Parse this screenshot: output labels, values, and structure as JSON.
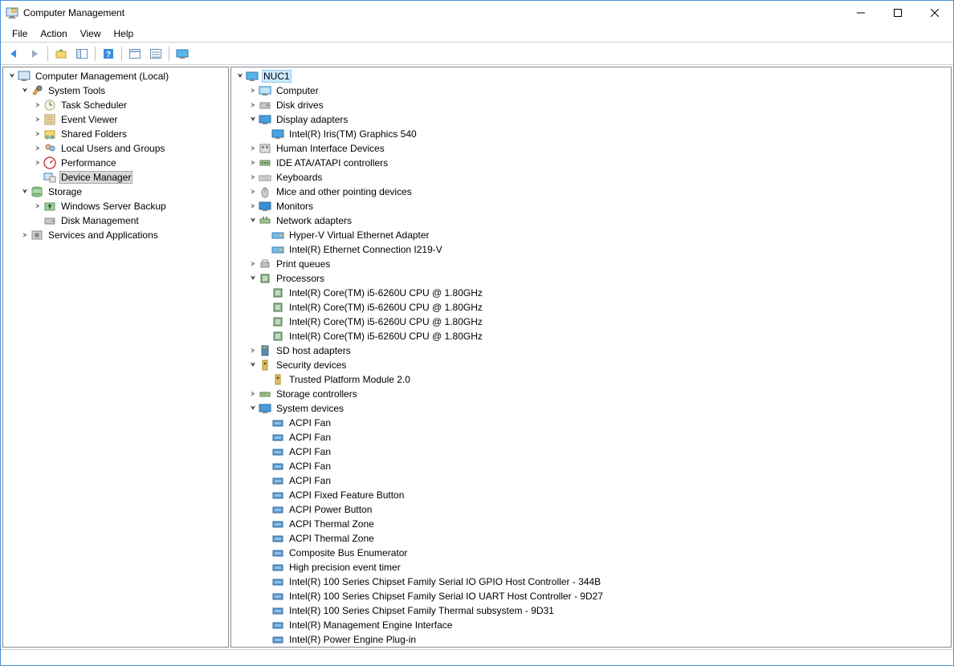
{
  "window": {
    "title": "Computer Management"
  },
  "menu": [
    "File",
    "Action",
    "View",
    "Help"
  ],
  "left_tree": {
    "root": "Computer Management (Local)",
    "system_tools": "System Tools",
    "task_scheduler": "Task Scheduler",
    "event_viewer": "Event Viewer",
    "shared_folders": "Shared Folders",
    "local_users": "Local Users and Groups",
    "performance": "Performance",
    "device_manager": "Device Manager",
    "storage": "Storage",
    "ws_backup": "Windows Server Backup",
    "disk_mgmt": "Disk Management",
    "services": "Services and Applications"
  },
  "right_tree": {
    "root": "NUC1",
    "computer": "Computer",
    "disk_drives": "Disk drives",
    "display_adapters": "Display adapters",
    "display_adapters_children": [
      "Intel(R) Iris(TM) Graphics 540"
    ],
    "hid": "Human Interface Devices",
    "ide": "IDE ATA/ATAPI controllers",
    "keyboards": "Keyboards",
    "mice": "Mice and other pointing devices",
    "monitors": "Monitors",
    "network": "Network adapters",
    "network_children": [
      "Hyper-V Virtual Ethernet Adapter",
      "Intel(R) Ethernet Connection I219-V"
    ],
    "print_queues": "Print queues",
    "processors": "Processors",
    "processors_children": [
      "Intel(R) Core(TM) i5-6260U CPU @ 1.80GHz",
      "Intel(R) Core(TM) i5-6260U CPU @ 1.80GHz",
      "Intel(R) Core(TM) i5-6260U CPU @ 1.80GHz",
      "Intel(R) Core(TM) i5-6260U CPU @ 1.80GHz"
    ],
    "sd_host": "SD host adapters",
    "security": "Security devices",
    "security_children": [
      "Trusted Platform Module 2.0"
    ],
    "storage_ctl": "Storage controllers",
    "system_devices": "System devices",
    "system_devices_children": [
      "ACPI Fan",
      "ACPI Fan",
      "ACPI Fan",
      "ACPI Fan",
      "ACPI Fan",
      "ACPI Fixed Feature Button",
      "ACPI Power Button",
      "ACPI Thermal Zone",
      "ACPI Thermal Zone",
      "Composite Bus Enumerator",
      "High precision event timer",
      "Intel(R) 100 Series Chipset Family Serial IO GPIO Host Controller - 344B",
      "Intel(R) 100 Series Chipset Family Serial IO UART Host Controller - 9D27",
      "Intel(R) 100 Series Chipset Family Thermal subsystem - 9D31",
      "Intel(R) Management Engine Interface",
      "Intel(R) Power Engine Plug-in"
    ]
  }
}
